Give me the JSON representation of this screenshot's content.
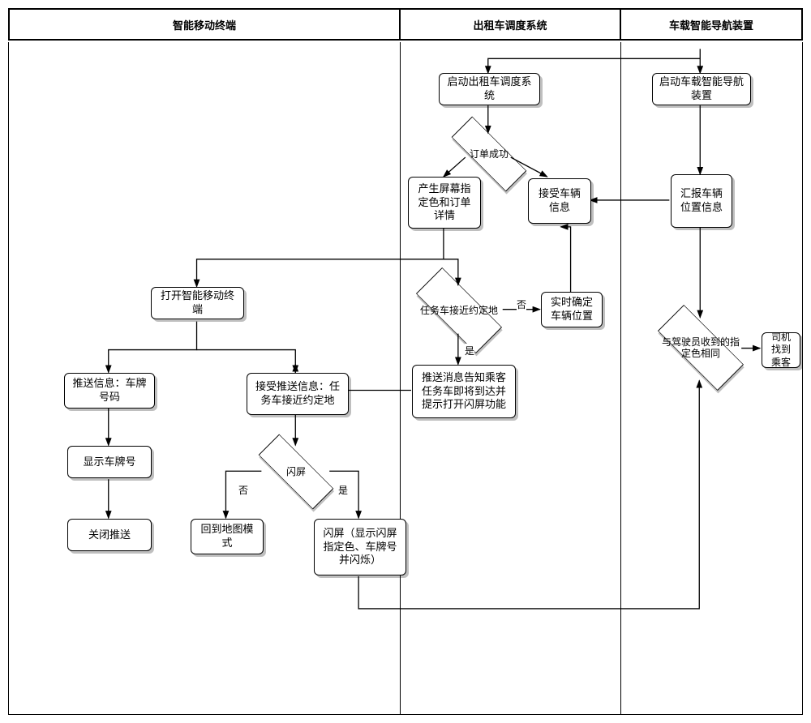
{
  "swimlanes": {
    "col1": "智能移动终端",
    "col2": "出租车调度系统",
    "col3": "车载智能导航装置"
  },
  "boxes": {
    "start_dispatch": "启动出租车调度系统",
    "start_nav": "启动车载智能导航装置",
    "order_success": "订单成功",
    "gen_color": "产生屏幕指定色和订单详情",
    "accept_vehicle": "接受车辆信息",
    "report_pos": "汇报车辆位置信息",
    "task_near": "任务车接近约定地",
    "realtime_pos": "实时确定车辆位置",
    "push_msg": "推送消息告知乘客任务车即将到达并提示打开闪屏功能",
    "open_terminal": "打开智能移动终端",
    "push_plate": "推送信息：车牌号码",
    "show_plate": "显示车牌号",
    "close_push": "关闭推送",
    "recv_push": "接受推送信息：任务车接近约定地",
    "flash": "闪屏",
    "return_map": "回到地图模式",
    "flash_display": "闪屏（显示闪屏指定色、车牌号并闪烁）",
    "same_color": "与驾驶员收到的指定色相同",
    "driver_find": "司机找到乘客"
  },
  "labels": {
    "yes": "是",
    "no": "否"
  }
}
